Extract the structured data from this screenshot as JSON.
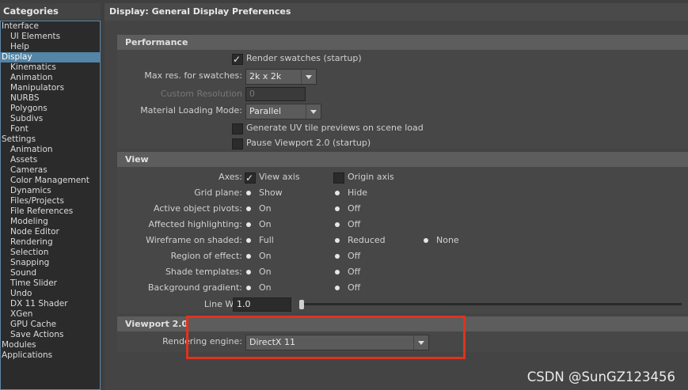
{
  "categories": {
    "title": "Categories",
    "items": [
      {
        "label": "Interface",
        "level": 0
      },
      {
        "label": "UI Elements",
        "level": 1
      },
      {
        "label": "Help",
        "level": 1
      },
      {
        "label": "Display",
        "level": 0,
        "selected": true
      },
      {
        "label": "Kinematics",
        "level": 1
      },
      {
        "label": "Animation",
        "level": 1
      },
      {
        "label": "Manipulators",
        "level": 1
      },
      {
        "label": "NURBS",
        "level": 1
      },
      {
        "label": "Polygons",
        "level": 1
      },
      {
        "label": "Subdivs",
        "level": 1
      },
      {
        "label": "Font",
        "level": 1
      },
      {
        "label": "Settings",
        "level": 0
      },
      {
        "label": "Animation",
        "level": 1
      },
      {
        "label": "Assets",
        "level": 1
      },
      {
        "label": "Cameras",
        "level": 1
      },
      {
        "label": "Color Management",
        "level": 1
      },
      {
        "label": "Dynamics",
        "level": 1
      },
      {
        "label": "Files/Projects",
        "level": 1
      },
      {
        "label": "File References",
        "level": 1
      },
      {
        "label": "Modeling",
        "level": 1
      },
      {
        "label": "Node Editor",
        "level": 1
      },
      {
        "label": "Rendering",
        "level": 1
      },
      {
        "label": "Selection",
        "level": 1
      },
      {
        "label": "Snapping",
        "level": 1
      },
      {
        "label": "Sound",
        "level": 1
      },
      {
        "label": "Time Slider",
        "level": 1
      },
      {
        "label": "Undo",
        "level": 1
      },
      {
        "label": "DX 11 Shader",
        "level": 1
      },
      {
        "label": "XGen",
        "level": 1
      },
      {
        "label": "GPU Cache",
        "level": 1
      },
      {
        "label": "Save Actions",
        "level": 1
      },
      {
        "label": "Modules",
        "level": 0
      },
      {
        "label": "Applications",
        "level": 0
      }
    ]
  },
  "panel_title": "Display: General Display Preferences",
  "performance": {
    "title": "Performance",
    "render_swatches": "Render swatches (startup)",
    "max_res_label": "Max res. for swatches:",
    "max_res_value": "2k x 2k",
    "custom_res_label": "Custom Resolution",
    "custom_res_value": "0",
    "material_mode_label": "Material Loading Mode:",
    "material_mode_value": "Parallel",
    "uv_previews": "Generate UV tile previews on scene load",
    "pause_viewport": "Pause Viewport 2.0 (startup)"
  },
  "view": {
    "title": "View",
    "axes_label": "Axes:",
    "view_axis": "View axis",
    "origin_axis": "Origin axis",
    "grid_label": "Grid plane:",
    "show": "Show",
    "hide": "Hide",
    "pivots_label": "Active object pivots:",
    "highlight_label": "Affected highlighting:",
    "wireframe_label": "Wireframe on shaded:",
    "full": "Full",
    "reduced": "Reduced",
    "none": "None",
    "region_label": "Region of effect:",
    "shade_label": "Shade templates:",
    "bg_label": "Background gradient:",
    "on": "On",
    "off": "Off",
    "line_width_label": "Line Width:",
    "line_width_value": "1.0"
  },
  "viewport": {
    "title": "Viewport 2.0",
    "engine_label": "Rendering engine:",
    "engine_value": "DirectX 11"
  },
  "watermark": "CSDN @SunGZ123456"
}
